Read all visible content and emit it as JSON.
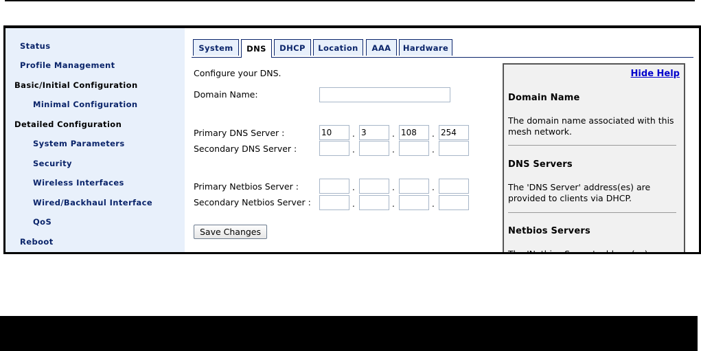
{
  "sidebar": {
    "items": [
      {
        "label": "Status"
      },
      {
        "label": "Profile Management"
      },
      {
        "label": "Basic/Initial Configuration"
      },
      {
        "label": "Minimal Configuration"
      },
      {
        "label": "Detailed Configuration"
      },
      {
        "label": "System Parameters"
      },
      {
        "label": "Security"
      },
      {
        "label": "Wireless Interfaces"
      },
      {
        "label": "Wired/Backhaul Interface"
      },
      {
        "label": "QoS"
      },
      {
        "label": "Reboot"
      }
    ]
  },
  "tabs": [
    {
      "label": "System"
    },
    {
      "label": "DNS",
      "active": true
    },
    {
      "label": "DHCP"
    },
    {
      "label": "Location"
    },
    {
      "label": "AAA"
    },
    {
      "label": "Hardware"
    }
  ],
  "form": {
    "intro": "Configure your DNS.",
    "domain_name_label": "Domain Name:",
    "domain_name_value": "",
    "primary_dns_label": "Primary DNS Server :",
    "primary_dns": [
      "10",
      "3",
      "108",
      "254"
    ],
    "secondary_dns_label": "Secondary DNS Server :",
    "secondary_dns": [
      "",
      "",
      "",
      ""
    ],
    "primary_netbios_label": "Primary Netbios Server :",
    "primary_netbios": [
      "",
      "",
      "",
      ""
    ],
    "secondary_netbios_label": "Secondary Netbios Server :",
    "secondary_netbios": [
      "",
      "",
      "",
      ""
    ],
    "separator": ".",
    "save_label": "Save Changes"
  },
  "help": {
    "hide_label": "Hide Help",
    "sections": [
      {
        "title": "Domain Name",
        "text": "The domain name associated with this mesh network."
      },
      {
        "title": "DNS Servers",
        "text": "The 'DNS Server' address(es) are provided to clients via DHCP."
      },
      {
        "title": "Netbios Servers",
        "text": "The 'Netbios Server' address(es) are"
      }
    ]
  },
  "colors": {
    "sidebar_bg": "#e8f0fb",
    "nav_blue": "#0a246a",
    "help_bg": "#f1f1f1",
    "link": "#0000cc"
  }
}
